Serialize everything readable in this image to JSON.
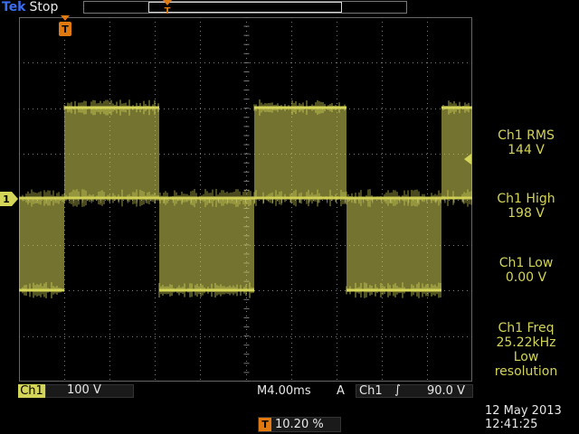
{
  "header": {
    "brand": "Tek",
    "acquisition_state": "Stop"
  },
  "markers": {
    "trigger_position": "T",
    "trigger_time_badge": "T",
    "channel_ground": "1"
  },
  "measurements": [
    {
      "label": "Ch1 RMS",
      "value": "144 V"
    },
    {
      "label": "Ch1 High",
      "value": "198 V"
    },
    {
      "label": "Ch1 Low",
      "value": "0.00 V"
    },
    {
      "label": "Ch1 Freq",
      "value": "25.22kHz",
      "note": "Low\nresolution"
    }
  ],
  "footer": {
    "channel_badge": "Ch1",
    "volts_per_div": "100 V",
    "timebase": "M4.00ms",
    "trigger_mode": "A",
    "trigger_source": "Ch1",
    "trigger_slope": "∫",
    "trigger_level": "90.0 V",
    "horizontal_position": "10.20 %",
    "date": "12 May 2013",
    "time": "12:41:25"
  },
  "colors": {
    "trace": "#d4d458",
    "grid": "#7a7a7a",
    "trigger_marker": "#e07a10",
    "brand": "#3a6df0"
  },
  "icons": {
    "trigger_marker": "triangle-T-icon",
    "channel_marker": "arrow-1-icon",
    "trigger_level_marker": "left-arrow-icon"
  }
}
